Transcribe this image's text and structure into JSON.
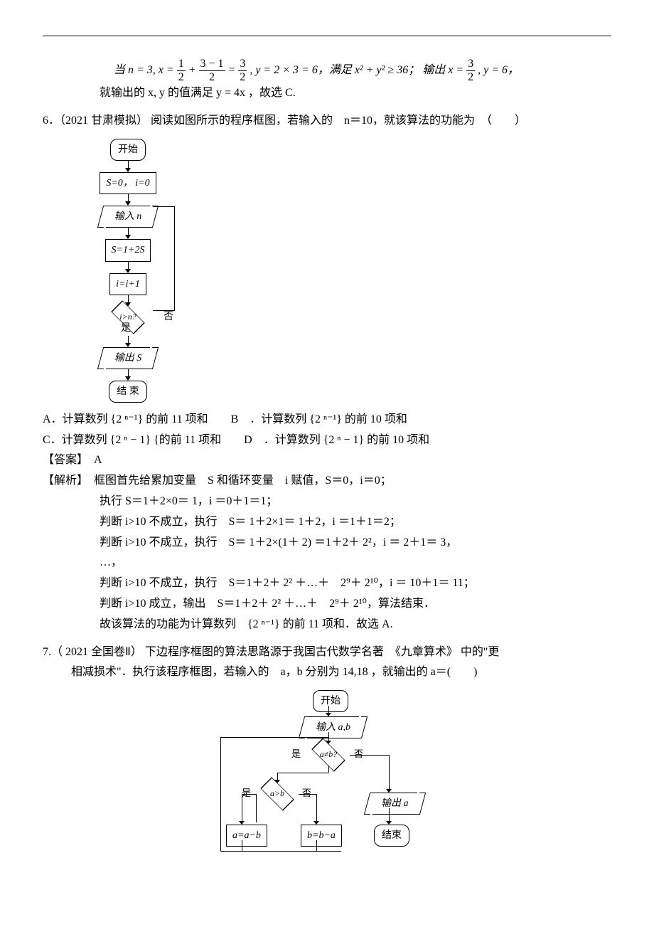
{
  "eq_block": {
    "prefix": "当 n = 3, x =",
    "f1n": "1",
    "f1d": "2",
    "plus": "+",
    "f2n": "3 − 1",
    "f2d": "2",
    "eq1": "=",
    "f3n": "3",
    "f3d": "2",
    "y_part": ", y = 2 × 3 = 6，满足 x² + y² ≥ 36； 输出 x =",
    "f4n": "3",
    "f4d": "2",
    "y_end": ", y = 6，",
    "line2": "就输出的 x, y 的值满足 y = 4x ，故选 C."
  },
  "q6": {
    "stem": "6．（2021 甘肃模拟） 阅读如图所示的程序框图，若输入的　n＝10，就该算法的功能为　（　　）",
    "fc": {
      "start": "开始",
      "init": "S=0， i=0",
      "input": "输入 n",
      "step1": "S=1+2S",
      "step2": "i=i+1",
      "cond": "i>n?",
      "yes": "是",
      "no": "否",
      "out": "输出 S",
      "end": "结 束"
    },
    "optA": "A．计算数列 {2 ⁿ⁻¹} 的前 11 项和　　B　．计算数列 {2 ⁿ⁻¹} 的前 10 项和",
    "optC": "C．计算数列 {2 ⁿ − 1} {的前 11 项和　　D　．计算数列 {2 ⁿ − 1} 的前 10 项和",
    "ans_label": "【答案】　A",
    "expl_label": "【解析】　框图首先给累加变量　S 和循环变量　i 赋值，S＝0，i＝0；",
    "e1": "执行 S＝1＋2×0＝ 1，i ＝0＋1＝1；",
    "e2": "判断 i>10 不成立，执行　S＝ 1＋2×1＝ 1＋2，i ＝1＋1＝2；",
    "e3": "判断 i>10 不成立，执行　S＝ 1＋2×(1＋ 2) ＝1＋2＋ 2²，i ＝ 2＋1＝ 3，",
    "e4": "…，",
    "e5": "判断 i>10 不成立，执行　S＝1＋2＋ 2² ＋…＋　2⁹＋ 2¹⁰，i ＝ 10＋1＝ 11；",
    "e6": "判断 i>10 成立，输出　S＝1＋2＋ 2² ＋…＋　2⁹＋ 2¹⁰，算法结束．",
    "e7": "故该算法的功能为计算数列　{2 ⁿ⁻¹} 的前 11 项和．故选 A."
  },
  "q7": {
    "stem1": "7.（ 2021 全国卷Ⅱ） 下边程序框图的算法思路源于我国古代数学名著　《九章算术》 中的\"更",
    "stem2": "相减损术\"．执行该程序框图，若输入的　a，b 分别为 14,18 ，就输出的 a＝(　　)",
    "fc": {
      "start": "开始",
      "input": "输入 a,b",
      "cond1": "a≠b?",
      "cond2": "a>b",
      "yes": "是",
      "no": "否",
      "r1": "a=a−b",
      "r2": "b=b−a",
      "out": "输出 a",
      "end": "结束"
    }
  }
}
